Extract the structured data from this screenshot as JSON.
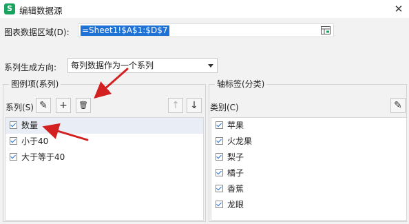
{
  "window": {
    "title": "编辑数据源",
    "app_icon_glyph": "S",
    "app_icon_color": "#1aa260",
    "close_glyph": "✕"
  },
  "range": {
    "label": "图表数据区域(D):",
    "value": "=Sheet1!$A$1:$D$7",
    "selection_color": "#1e72d6",
    "picker_icon": "range-picker-icon"
  },
  "direction": {
    "label": "系列生成方向:",
    "selected": "每列数据作为一个系列"
  },
  "legend_group": {
    "title": "图例项(系列)",
    "label": "系列(S)",
    "buttons": {
      "edit": "✎",
      "add": "+",
      "delete": "🗑",
      "up": "↑",
      "down": "↓"
    },
    "items": [
      {
        "label": "数量",
        "checked": true
      },
      {
        "label": "小于40",
        "checked": true
      },
      {
        "label": "大于等于40",
        "checked": true
      }
    ]
  },
  "axis_group": {
    "title": "轴标签(分类)",
    "label": "类别(C)",
    "buttons": {
      "edit": "✎"
    },
    "items": [
      {
        "label": "苹果",
        "checked": true
      },
      {
        "label": "火龙果",
        "checked": true
      },
      {
        "label": "梨子",
        "checked": true
      },
      {
        "label": "橘子",
        "checked": true
      },
      {
        "label": "香蕉",
        "checked": true
      },
      {
        "label": "龙眼",
        "checked": true
      }
    ]
  },
  "annotation_color": "#d32020"
}
